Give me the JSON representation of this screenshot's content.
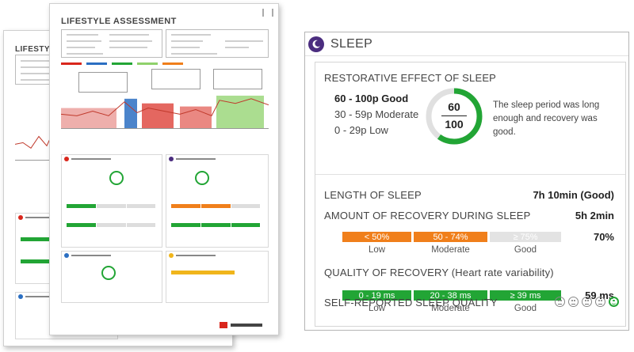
{
  "report": {
    "front_title": "LIFESTYLE ASSESSMENT",
    "back_title": "LIFESTYLE"
  },
  "card": {
    "title": "SLEEP",
    "header_icon": "moon-icon",
    "accent_color": "#4b2d7f",
    "restorative": {
      "title": "RESTORATIVE EFFECT OF SLEEP",
      "scale": [
        {
          "label": "60 - 100p Good",
          "strong": true
        },
        {
          "label": "30 - 59p Moderate",
          "strong": false
        },
        {
          "label": "0 - 29p Low",
          "strong": false
        }
      ],
      "gauge_score": "60",
      "gauge_max": "100",
      "gauge_fraction": 0.6,
      "description": "The sleep period was long enough and recovery was good."
    },
    "length": {
      "label": "LENGTH OF SLEEP",
      "value": "7h 10min (Good)"
    },
    "recovery_amount": {
      "label": "AMOUNT OF RECOVERY DURING SLEEP",
      "value": "5h 2min",
      "percent": "70%",
      "segments": [
        {
          "text": "< 50%",
          "label": "Low",
          "color": "#f07f1b",
          "active": true
        },
        {
          "text": "50 - 74%",
          "label": "Moderate",
          "color": "#f07f1b",
          "active": true
        },
        {
          "text": "≥ 75%",
          "label": "Good",
          "color": "#e3e3e3",
          "active": false
        }
      ]
    },
    "hrv": {
      "label": "QUALITY OF RECOVERY (Heart rate variability)",
      "value": "59 ms",
      "segments": [
        {
          "text": "0 - 19 ms",
          "label": "Low",
          "color": "#22a535",
          "active": true
        },
        {
          "text": "20 - 38 ms",
          "label": "Moderate",
          "color": "#22a535",
          "active": true
        },
        {
          "text": "≥ 39 ms",
          "label": "Good",
          "color": "#22a535",
          "active": true
        }
      ]
    },
    "self_reported": {
      "label": "SELF-REPORTED SLEEP QUALITY",
      "faces": [
        "very-sad-face-icon",
        "sad-face-icon",
        "neutral-face-icon",
        "smile-face-icon",
        "happy-face-icon"
      ],
      "selected_index": 4
    }
  }
}
